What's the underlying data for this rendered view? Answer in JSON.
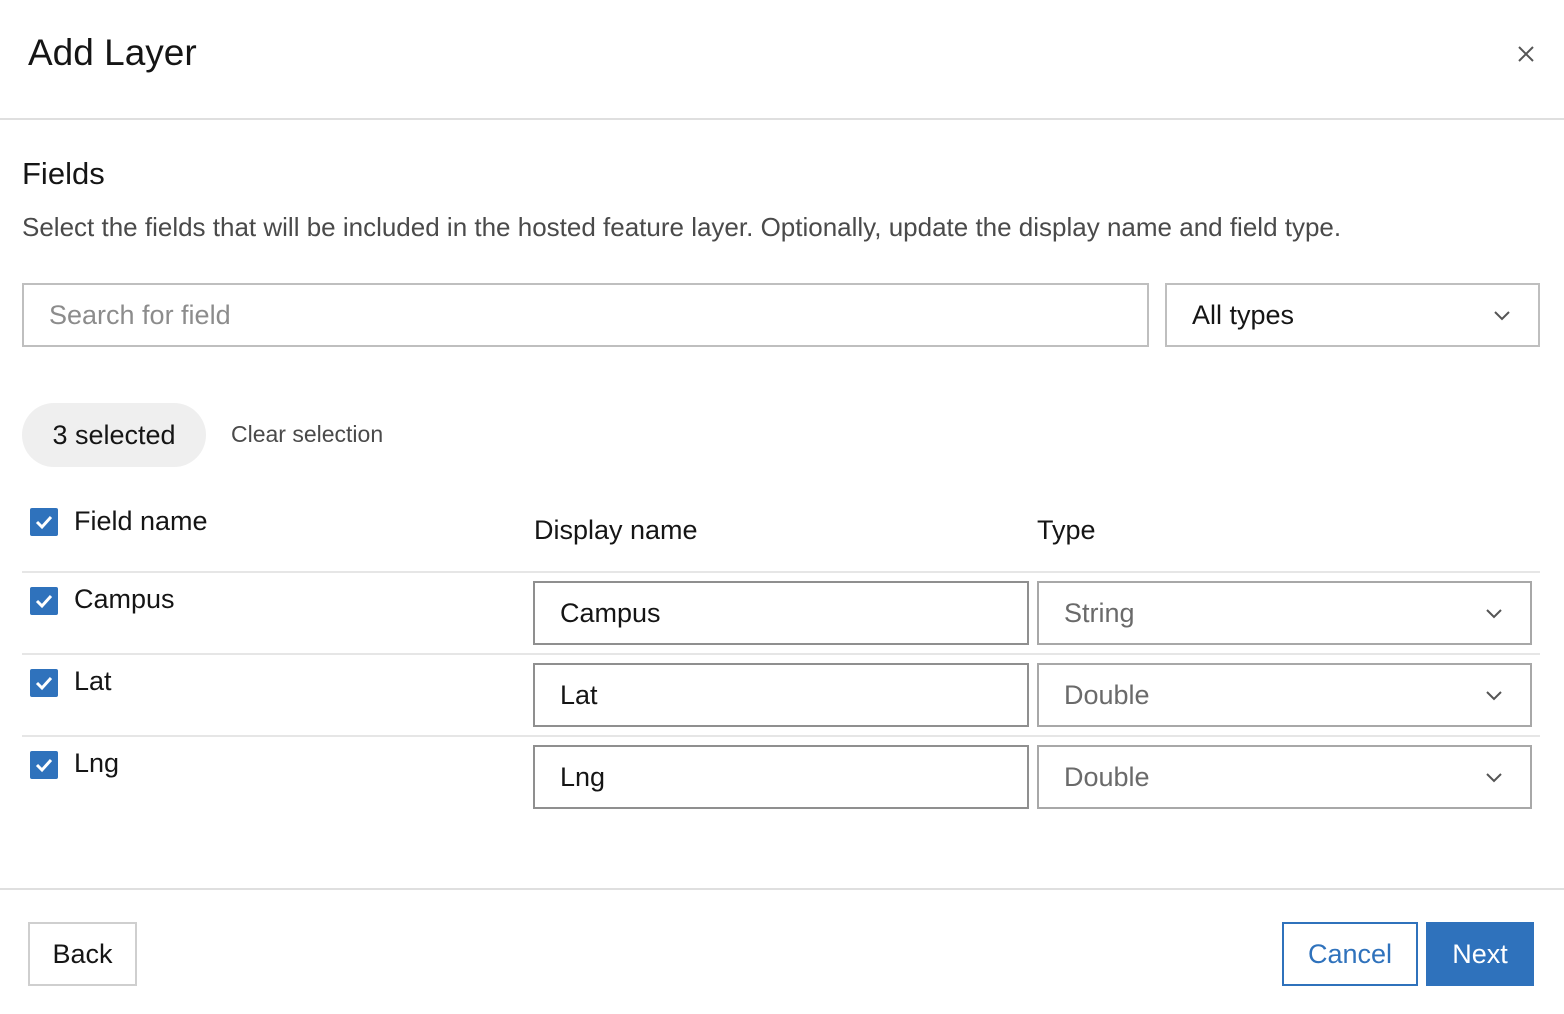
{
  "dialog": {
    "title": "Add Layer",
    "close_icon": "close-icon"
  },
  "fields_section": {
    "title": "Fields",
    "description": "Select the fields that will be included in the hosted feature layer. Optionally, update the display name and field type.",
    "search": {
      "placeholder": "Search for field",
      "value": ""
    },
    "type_filter": {
      "selected": "All types"
    }
  },
  "selection": {
    "chip_label": "3 selected",
    "clear_label": "Clear selection"
  },
  "table": {
    "columns": [
      "Field name",
      "Display name",
      "Type"
    ],
    "header_checked": true,
    "rows": [
      {
        "field_name": "Campus",
        "display_name": "Campus",
        "type": "String",
        "checked": true
      },
      {
        "field_name": "Lat",
        "display_name": "Lat",
        "type": "Double",
        "checked": true
      },
      {
        "field_name": "Lng",
        "display_name": "Lng",
        "type": "Double",
        "checked": true
      }
    ]
  },
  "footer": {
    "back_label": "Back",
    "cancel_label": "Cancel",
    "next_label": "Next"
  },
  "colors": {
    "accent": "#2f72bc",
    "border": "#bfbfbf",
    "chip_bg": "#efefef"
  }
}
